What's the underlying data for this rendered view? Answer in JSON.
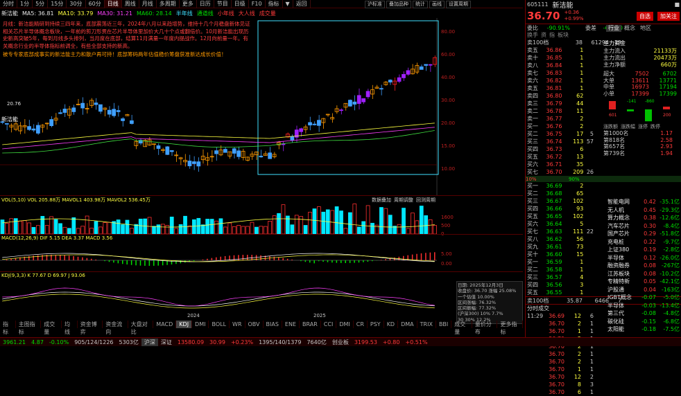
{
  "tabs": [
    "分时",
    "1分",
    "5分",
    "15分",
    "30分",
    "60分",
    "日线",
    "周线",
    "月线",
    "多周期",
    "更多",
    "日历",
    "节目",
    "日级",
    "F10",
    "指标",
    "▼",
    "返回"
  ],
  "active_tab": "日线",
  "toolbar_right": [
    "沪标准",
    "叠加品种",
    "统计",
    "画线",
    "设置周期"
  ],
  "ma_line": {
    "name": "新洁能",
    "items": [
      "MA5: 36.81",
      "MA10: 33.79",
      "MA30: 31.21",
      "MA60: 28.14",
      "半年线",
      "通道线",
      "小年线",
      "大人线",
      "成交量"
    ]
  },
  "annotation": "月线：新洁能精研到持续三四年来，底部震荡近三年，2024年八月以来趋增势，维持十几个月稳盘新体见证相关芯片半导体概念板块，一年前的剪刀形贯在芯片半导体里加价大几十个点或翻倍价。10月新洁能出现历史新高突破5年，每到月线多头排列，当月度在底部，结算11月满量一年度内提战作。12月向前量一年。有关概念行业的半导体指标前调全，有些全部支持的新高。",
  "annotation2": "被专专家底部成事实的新洁能主力和散户再可持！底部筹码两年估值稳价筹盘获准新达成长价值！",
  "price_marker": "78.43",
  "low_marker": "20.76",
  "left_label": "新洁能",
  "y_axis": [
    "80.00",
    "60.00",
    "40.00",
    "30.00",
    "20.00",
    "15.00",
    "10.00"
  ],
  "vol_label": "VOL(5,10) VOL 205.88万 MAVOL1 403.98万 MAVOL2 536.45万",
  "vol_tabs": [
    "数据叠加",
    "周期调整",
    "回测周期"
  ],
  "vol_axis": [
    "1600",
    "500",
    "0"
  ],
  "macd_label": "MACD(12,26,9) DIF 5.15 DEA 3.37 MACD 3.56",
  "kdj_label": "KDJ(9,3,3) K 77.67 D 69.97 J 93.06",
  "macd_axis": [
    "5.00",
    "0.00"
  ],
  "x_dates": [
    "2024",
    "2025"
  ],
  "info_box": [
    "日期: 2025年12月3日",
    "收盘价: 36.70 涨幅 25.08%",
    "一个估值 10.00%",
    "区间涨幅: 76.32%",
    "区间振幅: 77.32%",
    "(沪深300) 10% 7.7%",
    "30 30% 12.2%"
  ],
  "tools": [
    "指标",
    "主图指标",
    "成交量",
    "均线",
    "资金博弈",
    "资金流向",
    "大盘对比",
    "MACD",
    "KDJ",
    "DMI",
    "BOLL",
    "WR",
    "OBV",
    "BIAS",
    "ENE",
    "BRAR",
    "CCI",
    "DMI",
    "CR",
    "PSY",
    "KD",
    "DMA",
    "TRIX",
    "BBI",
    "成交量",
    "量价分布",
    "更多指标"
  ],
  "right": {
    "code": "605111",
    "name": "新洁能",
    "price": "36.70",
    "chg": "+0.36",
    "pct": "+0.99%",
    "hdr_btns": [
      "■",
      "自选",
      "加关注"
    ],
    "r1": [
      "委比",
      "-90.91%",
      "委差",
      "-64020"
    ],
    "r2": [
      "换手",
      "资",
      "指",
      "板块"
    ],
    "cnt": [
      "卖100档",
      "38",
      "61294",
      "13"
    ],
    "sell": [
      [
        "卖五",
        "36.86",
        "1"
      ],
      [
        "卖十",
        "36.85",
        "1"
      ],
      [
        "卖八",
        "36.84",
        "1"
      ],
      [
        "卖七",
        "36.83",
        "1"
      ],
      [
        "卖六",
        "36.82",
        "1"
      ],
      [
        "卖五",
        "36.81",
        "1"
      ],
      [
        "卖四",
        "36.80",
        "62"
      ],
      [
        "卖三",
        "36.79",
        "44"
      ],
      [
        "卖二",
        "36.78",
        "11"
      ],
      [
        "卖一",
        "36.77",
        "2"
      ],
      [
        "买一",
        "36.76",
        "2"
      ],
      [
        "买二",
        "36.75",
        "17"
      ],
      [
        "买三",
        "36.74",
        "113"
      ],
      [
        "买四",
        "36.73",
        "6"
      ],
      [
        "买五",
        "36.72",
        "13"
      ],
      [
        "买六",
        "36.71",
        "35"
      ],
      [
        "买七",
        "36.70",
        "209"
      ]
    ],
    "sell_flag": [
      "5",
      "57",
      "26"
    ],
    "fund": {
      "title": "主力资金",
      "rows": [
        [
          "主力流入",
          "21133万"
        ],
        [
          "主力流出",
          "20473万"
        ],
        [
          "主力净额",
          "660万"
        ]
      ]
    },
    "big": [
      [
        "超大",
        "7502",
        "6702"
      ],
      [
        "大单",
        "13611",
        "13771"
      ],
      [
        "中单",
        "16973",
        "17194"
      ],
      [
        "小单",
        "17399",
        "17399"
      ]
    ],
    "bar_vals": [
      "601",
      "-141",
      "-860",
      "200"
    ],
    "tabs2": [
      "涨跌额",
      "涨跌幅",
      "涨停",
      "跌停"
    ],
    "rank": [
      [
        "第1000名",
        "1.17"
      ],
      [
        "第818名",
        "2.58"
      ],
      [
        "第657名",
        "2.93"
      ],
      [
        "第739名",
        "1.94"
      ]
    ],
    "mid_pct": [
      "10%",
      "90%"
    ],
    "buy": [
      [
        "买一",
        "36.69",
        "2"
      ],
      [
        "买二",
        "36.68",
        "65"
      ],
      [
        "买三",
        "36.67",
        "102"
      ],
      [
        "买四",
        "36.66",
        "93"
      ],
      [
        "买五",
        "36.65",
        "102"
      ],
      [
        "买六",
        "36.64",
        "5"
      ],
      [
        "买七",
        "36.63",
        "111"
      ],
      [
        "买八",
        "36.62",
        "56"
      ],
      [
        "买九",
        "36.61",
        "73"
      ],
      [
        "买十",
        "36.60",
        "15"
      ],
      [
        "买一",
        "36.59",
        "1"
      ],
      [
        "买二",
        "36.58",
        "1"
      ],
      [
        "买三",
        "36.57",
        "4"
      ],
      [
        "买四",
        "36.56",
        "3"
      ],
      [
        "买五",
        "36.55",
        "1"
      ]
    ],
    "bflag": [
      "22"
    ],
    "bcnt": [
      "卖100档",
      "35.87",
      "6466",
      "7"
    ],
    "trade_title": "分时成交",
    "trades": [
      [
        "11:29",
        "36.69",
        "12",
        "6"
      ],
      [
        "",
        "36.70",
        "2",
        "1"
      ],
      [
        "",
        "36.70",
        "1",
        "1"
      ],
      [
        "",
        "36.70",
        "2",
        "1"
      ],
      [
        "",
        "36.70",
        "2",
        "1"
      ],
      [
        "",
        "36.70",
        "2",
        "1"
      ],
      [
        "",
        "36.70",
        "2",
        "1"
      ],
      [
        "",
        "36.70",
        "1",
        "1"
      ],
      [
        "",
        "36.70",
        "12",
        "2"
      ],
      [
        "",
        "36.70",
        "8",
        "3"
      ],
      [
        "",
        "36.70",
        "6",
        "1"
      ]
    ],
    "sectors": [
      [
        "智能电网",
        "0.42",
        "-35.1亿"
      ],
      [
        "无人机",
        "0.45",
        "-29.3亿"
      ],
      [
        "算力概念",
        "0.38",
        "-12.6亿"
      ],
      [
        "汽车芯片",
        "0.30",
        "-8.4亿"
      ],
      [
        "国产芯片",
        "0.29",
        "-51.8亿"
      ],
      [
        "充电桩",
        "0.22",
        "-9.7亿"
      ],
      [
        "上证380",
        "0.19",
        "-2.8亿"
      ],
      [
        "半导体",
        "0.12",
        "-26.0亿"
      ],
      [
        "融资融券",
        "0.08",
        "-267亿"
      ],
      [
        "江苏板块",
        "0.08",
        "-10.2亿"
      ],
      [
        "专精特新",
        "0.05",
        "-42.1亿"
      ],
      [
        "沪股通",
        "0.04",
        "-163亿"
      ],
      [
        "IGBT概念",
        "-0.07",
        "-5.0亿"
      ],
      [
        "半导体",
        "-0.03",
        "-13.4亿"
      ],
      [
        "第三代",
        "-0.08",
        "-4.8亿"
      ],
      [
        "碳化硅",
        "-0.15",
        "-6.8亿"
      ],
      [
        "太阳能",
        "-0.18",
        "-7.5亿"
      ]
    ],
    "sect_tabs": [
      "行业",
      "概念",
      "地区"
    ]
  },
  "bottom": {
    "sh": "3961.21",
    "sh_chg": "4.87",
    "sh_pct": "-0.10%",
    "sh_vol": "905/124/1226",
    "sh_amt": "5303亿",
    "sz_name": "深证",
    "sz": "13580.09",
    "sz_chg": "30.99",
    "sz_pct": "+0.23%",
    "sz_vol": "1395/140/1379",
    "sz_amt": "7640亿",
    "cy_name": "创业板",
    "cy": "3199.53",
    "cy_chg": "+0.80",
    "cy_pct": "+0.51%",
    "mid": [
      "沪深",
      "沪深京",
      "指数"
    ]
  }
}
